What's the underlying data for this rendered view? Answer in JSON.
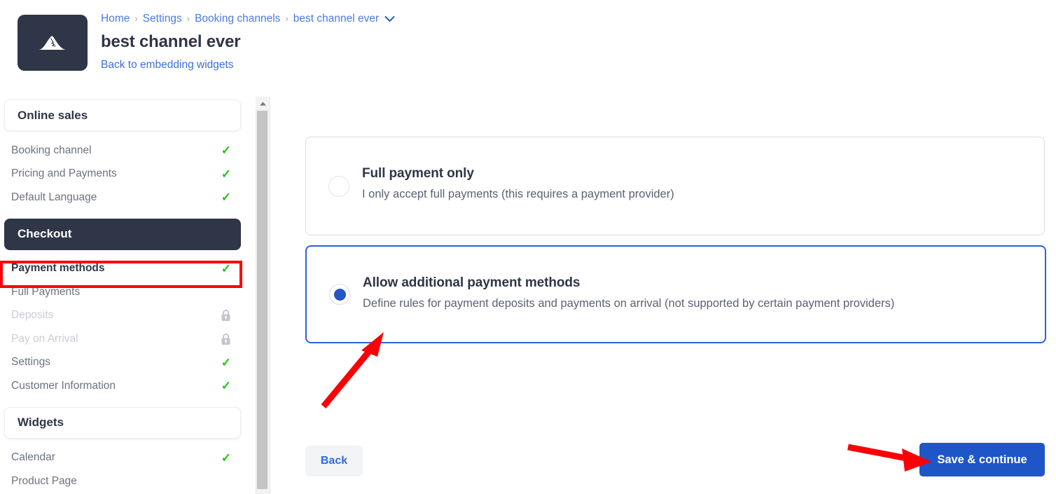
{
  "header": {
    "logo_icon": "mountain-icon",
    "breadcrumb": [
      {
        "label": "Home"
      },
      {
        "label": "Settings"
      },
      {
        "label": "Booking channels"
      },
      {
        "label": "best channel ever"
      }
    ],
    "breadcrumb_separator": "›",
    "breadcrumb_caret_icon": "chevron-down-icon",
    "title": "best channel ever",
    "back_link": "Back to embedding widgets"
  },
  "sidebar": {
    "sections": [
      {
        "type": "header",
        "label": "Online sales",
        "style": "light"
      },
      {
        "type": "item",
        "label": "Booking channel",
        "status": "check"
      },
      {
        "type": "item",
        "label": "Pricing and Payments",
        "status": "check"
      },
      {
        "type": "item",
        "label": "Default Language",
        "status": "check"
      },
      {
        "type": "header",
        "label": "Checkout",
        "style": "dark"
      },
      {
        "type": "item",
        "label": "Payment methods",
        "status": "check",
        "active": true,
        "highlighted": true
      },
      {
        "type": "item",
        "label": "Full Payments",
        "status": "none"
      },
      {
        "type": "item",
        "label": "Deposits",
        "status": "lock",
        "disabled": true
      },
      {
        "type": "item",
        "label": "Pay on Arrival",
        "status": "lock",
        "disabled": true
      },
      {
        "type": "item",
        "label": "Settings",
        "status": "check"
      },
      {
        "type": "item",
        "label": "Customer Information",
        "status": "check"
      },
      {
        "type": "header",
        "label": "Widgets",
        "style": "light"
      },
      {
        "type": "item",
        "label": "Calendar",
        "status": "check"
      },
      {
        "type": "item",
        "label": "Product Page",
        "status": "none"
      }
    ],
    "check_icon": "check-icon",
    "lock_icon": "lock-icon",
    "scrollbar": {
      "up_arrow_icon": "scroll-up-arrow-icon"
    }
  },
  "main": {
    "options": [
      {
        "id": "full-payment-only",
        "title": "Full payment only",
        "description": "I only accept full payments (this requires a payment provider)",
        "selected": false
      },
      {
        "id": "allow-additional-payment-methods",
        "title": "Allow additional payment methods",
        "description": "Define rules for payment deposits and payments on arrival (not supported by certain payment providers)",
        "selected": true
      }
    ],
    "back_button": "Back",
    "save_button": "Save & continue"
  },
  "annotations": {
    "highlight_color": "#fb0007",
    "arrow_to_radio": "red-arrow-icon",
    "arrow_to_save": "red-arrow-icon",
    "highlight_box_target": "Payment methods"
  },
  "colors": {
    "accent_blue": "#1e56c8",
    "link_blue": "#3a6fe0",
    "dark_navy": "#2e3647",
    "check_green": "#22c417",
    "annotation_red": "#fb0007"
  }
}
